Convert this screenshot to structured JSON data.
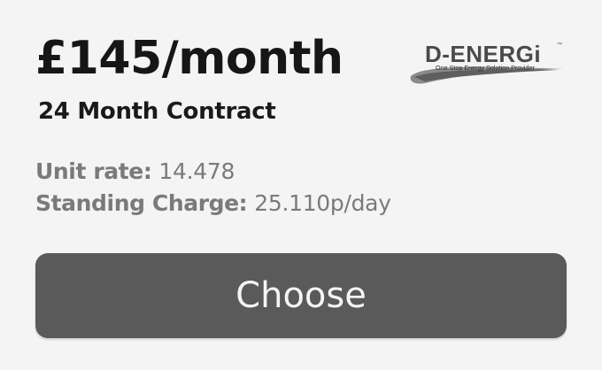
{
  "plan": {
    "price": "£145/month",
    "contract": "24 Month Contract"
  },
  "rates": {
    "unit_rate_label": "Unit rate:",
    "unit_rate_value": "14.478",
    "standing_charge_label": "Standing Charge:",
    "standing_charge_value": "25.110p/day"
  },
  "logo": {
    "name": "D-ENERGi",
    "tagline": "One Stop Energy Solution Provider",
    "trademark": "™"
  },
  "actions": {
    "choose_label": "Choose"
  },
  "colors": {
    "background": "#f4f4f4",
    "button": "#5a5a5a",
    "button_text": "#f4f4f4",
    "heading_text": "#161616",
    "muted_text": "#7a7a7a"
  }
}
